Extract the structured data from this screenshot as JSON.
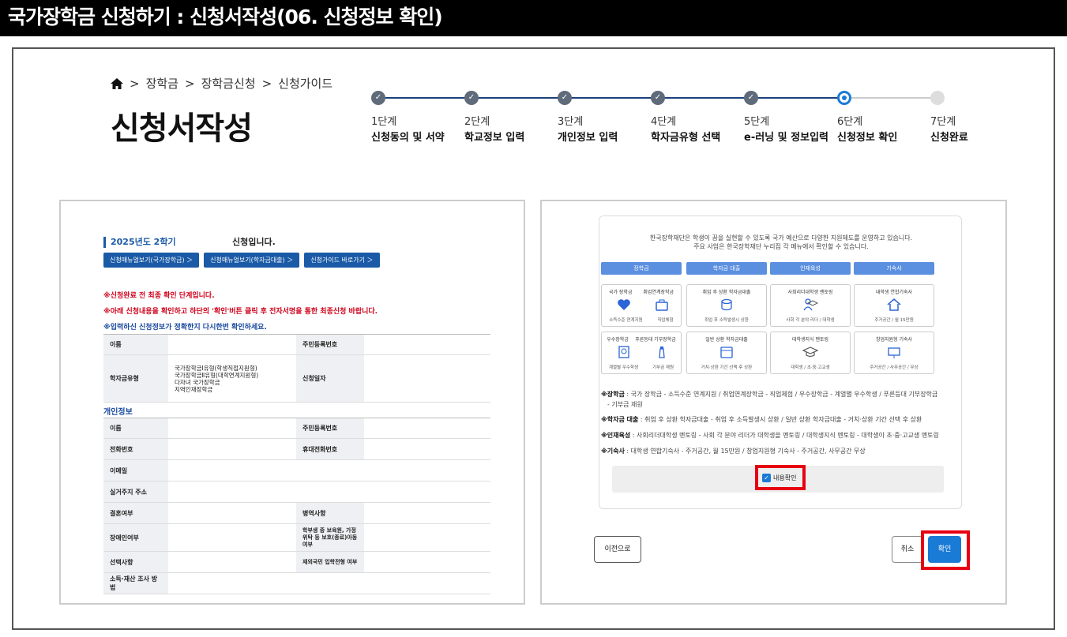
{
  "header": {
    "title": "국가장학금 신청하기 : 신청서작성(06. 신청정보 확인)"
  },
  "breadcrumb": {
    "items": [
      "장학금",
      "장학금신청",
      "신청가이드"
    ]
  },
  "page": {
    "title": "신청서작성"
  },
  "steps": [
    {
      "num": "1단계",
      "name": "신청동의 및 서약",
      "state": "done"
    },
    {
      "num": "2단계",
      "name": "학교정보 입력",
      "state": "done"
    },
    {
      "num": "3단계",
      "name": "개인정보 입력",
      "state": "done"
    },
    {
      "num": "4단계",
      "name": "학자금유형 선택",
      "state": "done"
    },
    {
      "num": "5단계",
      "name": "e-러닝 및 정보입력",
      "state": "done"
    },
    {
      "num": "6단계",
      "name": "신청정보 확인",
      "state": "current"
    },
    {
      "num": "7단계",
      "name": "신청완료",
      "state": "todo"
    }
  ],
  "left": {
    "year": "2025년도 2학기",
    "year_suffix": "신청입니다.",
    "buttons": [
      "신청매뉴얼보기(국가장학금) ＞",
      "신청매뉴얼보기(학자금대출) ＞",
      "신청가이드 바로가기 ＞"
    ],
    "notices": [
      "※신청완료 전 최종 확인 단계입니다.",
      "※아래 신청내용을 확인하고 하단의 '확인'버튼 클릭 후 전자서명을 통한 최종신청 바랍니다.",
      "※입력하신 신청정보가 정확한지 다시한번 확인하세요."
    ],
    "t1": {
      "name": "이름",
      "rrn": "주민등록번호",
      "type": "학자금유형",
      "type_values": [
        "국가장학금Ⅰ유형(학생직접지원형)",
        "국가장학금Ⅱ유형(대학연계지원형)",
        "다자녀 국가장학금",
        "지역인재장학금"
      ],
      "date": "신청일자"
    },
    "section_personal": "개인정보",
    "t2": {
      "name": "이름",
      "rrn": "주민등록번호",
      "phone": "전화번호",
      "mobile": "휴대전화번호",
      "email": "이메일",
      "address": "실거주지 주소",
      "marriage": "결혼여부",
      "military": "병역사항",
      "disability": "장애인여부",
      "guardian": "학부생 중 보육원, 가정위탁 등 보호(종료)아동 여부",
      "optional": "선택사항",
      "overseas": "재외국민 입학전형 여부",
      "income": "소득·재산 조사 방법"
    }
  },
  "right": {
    "intro": [
      "한국장학재단은 학생이 꿈을 실현할 수 있도록 국가 예산으로 다양한 지원제도를 운영하고 있습니다.",
      "주요 사업은 한국장학재단 누리집 각 메뉴에서 확인할 수 있습니다."
    ],
    "cols": [
      "장학금",
      "학자금 대출",
      "인재육성",
      "기숙사"
    ],
    "boxes": [
      {
        "t": "국가 장학금",
        "b": "소득수준 연계지원"
      },
      {
        "t": "취업연계장학금",
        "b": "직업체험"
      },
      {
        "t": "취업 후 상환 학자금대출",
        "b": "취업 후 소득발생시 상환"
      },
      {
        "t": "사회리더대학생 멘토링",
        "b": "사회 각 분야 리더 / 대학생"
      },
      {
        "t": "대학생 연합기숙사",
        "b": "주거공간 / 월 15만원"
      },
      {
        "t": "우수장학금",
        "b": "계열별 우수학생"
      },
      {
        "t": "푸른등대 기부장학금",
        "b": "기부금 재원"
      },
      {
        "t": "일반 상환 학자금대출",
        "b": "거치·상환 기간 선택 후 상환"
      },
      {
        "t": "대학생지식 멘토링",
        "b": "대학생 / 초·중·고교생"
      },
      {
        "t": "창업지원형 기숙사",
        "b": "주거공간 / 사무공간 / 무상"
      }
    ],
    "legend": [
      {
        "k": "※장학금",
        "v": " : 국가 장학금 - 소득수준 연계지원 / 취업연계장학금 - 직업체험 / 우수장학금 - 계열별 우수학생 / 푸른등대 기부장학금"
      },
      {
        "k": "",
        "v": "  - 기부금 재원"
      },
      {
        "k": "※학자금 대출",
        "v": " : 취업 후 상환 학자금대출 - 취업 후 소득발생시 상환 / 일반 상환 학자금대출 - 거치·상환 기간 선택 후 상환"
      },
      {
        "k": "※인재육성",
        "v": " : 사회리더대학생 멘토링 - 사회 각 분야 리더가 대학생을 멘토링 / 대학생지식 멘토링 - 대학생이 초·중·고교생 멘토링"
      },
      {
        "k": "※기숙사",
        "v": " : 대학생 연합기숙사 - 주거공간, 월 15만원 / 창업지원형 기숙사 - 주거공간, 사무공간 무상"
      }
    ],
    "confirm_label": "내용확인",
    "prev": "이전으로",
    "cancel": "취소",
    "ok": "확인"
  },
  "colors": {
    "accent": "#1a7bd6",
    "navy": "#1a5aa6",
    "highlight": "#e60012"
  }
}
